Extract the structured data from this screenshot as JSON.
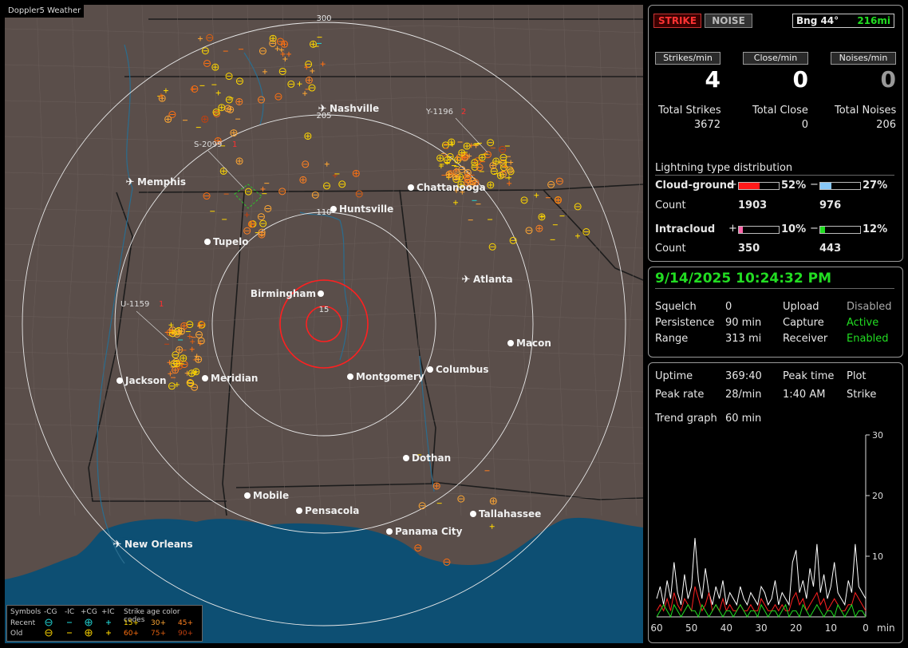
{
  "app_title": "Doppler5 Weather",
  "header": {
    "strike_label": "STRIKE",
    "noise_label": "NOISE",
    "bearing": "Bng 44°",
    "distance": "216mi"
  },
  "rates": {
    "strikes_label": "Strikes/min",
    "close_label": "Close/min",
    "noises_label": "Noises/min",
    "strikes_value": "4",
    "close_value": "0",
    "noises_value": "0"
  },
  "totals": {
    "strikes_label": "Total Strikes",
    "close_label": "Total Close",
    "noises_label": "Total Noises",
    "strikes_value": "3672",
    "close_value": "0",
    "noises_value": "206"
  },
  "distribution": {
    "title": "Lightning type distribution",
    "cg_label": "Cloud-ground",
    "ic_label": "Intracloud",
    "count_label": "Count",
    "plus": "+",
    "minus": "−",
    "cg_pos_pct": "52%",
    "cg_neg_pct": "27%",
    "cg_pos_count": "1903",
    "cg_neg_count": "976",
    "ic_pos_pct": "10%",
    "ic_neg_pct": "12%",
    "ic_pos_count": "350",
    "ic_neg_count": "443",
    "cg_pos_fill": 0.52,
    "cg_neg_fill": 0.27,
    "ic_pos_fill": 0.1,
    "ic_neg_fill": 0.12,
    "colors": {
      "cg_pos": "#ff1a1a",
      "cg_neg": "#88c8f8",
      "ic_pos": "#ff66aa",
      "ic_neg": "#22dd22"
    }
  },
  "status": {
    "datetime": "9/14/2025 10:24:32 PM",
    "squelch_label": "Squelch",
    "squelch_value": "0",
    "persistence_label": "Persistence",
    "persistence_value": "90 min",
    "range_label": "Range",
    "range_value": "313 mi",
    "upload_label": "Upload",
    "upload_value": "Disabled",
    "capture_label": "Capture",
    "capture_value": "Active",
    "receiver_label": "Receiver",
    "receiver_value": "Enabled"
  },
  "stats": {
    "uptime_label": "Uptime",
    "uptime_value": "369:40",
    "peak_time_label": "Peak time",
    "peak_time_value": "1:40 AM",
    "plot_label": "Plot",
    "plot_value": "Strike",
    "peak_rate_label": "Peak rate",
    "peak_rate_value": "28/min",
    "trend_label": "Trend graph",
    "trend_value": "60 min"
  },
  "chart_data": {
    "type": "line",
    "x_ticks": [
      "60",
      "50",
      "40",
      "30",
      "20",
      "10",
      "0"
    ],
    "x_unit": "min",
    "y_ticks": [
      "30",
      "20",
      "10"
    ],
    "ylim": [
      0,
      30
    ],
    "xlim": [
      60,
      0
    ],
    "series": [
      {
        "color": "#ffffff",
        "values": [
          3,
          5,
          2,
          6,
          3,
          9,
          4,
          2,
          7,
          3,
          5,
          13,
          6,
          3,
          8,
          4,
          2,
          5,
          3,
          6,
          2,
          4,
          3,
          2,
          5,
          3,
          2,
          4,
          3,
          2,
          5,
          4,
          2,
          3,
          6,
          2,
          4,
          3,
          2,
          9,
          11,
          4,
          6,
          3,
          8,
          5,
          12,
          4,
          7,
          3,
          5,
          9,
          4,
          3,
          2,
          6,
          4,
          12,
          5,
          4,
          3
        ]
      },
      {
        "color": "#ff2020",
        "values": [
          1,
          2,
          1,
          3,
          1,
          4,
          2,
          1,
          3,
          2,
          1,
          5,
          3,
          1,
          2,
          4,
          1,
          2,
          1,
          3,
          1,
          2,
          1,
          1,
          2,
          1,
          1,
          2,
          1,
          1,
          3,
          2,
          1,
          1,
          2,
          1,
          2,
          1,
          1,
          3,
          4,
          2,
          3,
          1,
          2,
          3,
          4,
          2,
          3,
          1,
          2,
          3,
          2,
          1,
          1,
          2,
          2,
          4,
          3,
          2,
          1
        ]
      },
      {
        "color": "#22dd22",
        "values": [
          0,
          1,
          2,
          1,
          0,
          2,
          1,
          0,
          1,
          2,
          1,
          1,
          0,
          2,
          1,
          0,
          1,
          2,
          1,
          0,
          1,
          1,
          0,
          1,
          2,
          1,
          0,
          1,
          1,
          0,
          2,
          1,
          0,
          1,
          1,
          0,
          1,
          2,
          0,
          1,
          1,
          0,
          2,
          1,
          0,
          1,
          2,
          1,
          0,
          1,
          1,
          0,
          2,
          1,
          0,
          1,
          2,
          0,
          1,
          1,
          0
        ]
      }
    ]
  },
  "map": {
    "range_labels": [
      "300",
      "205",
      "110",
      "15"
    ],
    "airports": [
      "Nashville",
      "Memphis",
      "Atlanta",
      "New Orleans"
    ],
    "cities": [
      "Chattanooga",
      "Huntsville",
      "Tupelo",
      "Birmingham",
      "Macon",
      "Jackson",
      "Meridian",
      "Montgomery",
      "Columbus",
      "Dothan",
      "Mobile",
      "Pensacola",
      "Tallahassee",
      "Panama City"
    ],
    "storm_tags": [
      "Y-1196",
      "2",
      "S-2099",
      "1",
      "U-1159",
      "1"
    ]
  },
  "legend": {
    "symbols_label": "Symbols",
    "cols": [
      "-CG",
      "-IC",
      "+CG",
      "+IC"
    ],
    "age_label": "Strike age color codes",
    "recent_label": "Recent",
    "old_label": "Old",
    "ages_recent": [
      "15+",
      "30+",
      "45+"
    ],
    "ages_old": [
      "60+",
      "75+",
      "90+"
    ],
    "age_colors": [
      "#ffd700",
      "#ffa733",
      "#ff8020",
      "#ff7010",
      "#e06010",
      "#c04010"
    ]
  }
}
